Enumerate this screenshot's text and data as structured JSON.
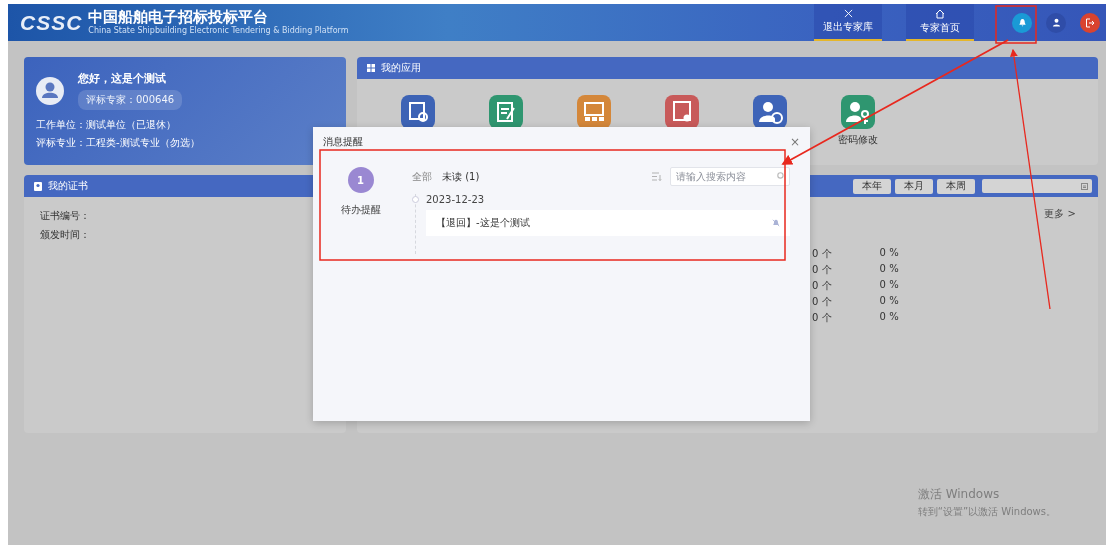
{
  "header": {
    "logo": "CSSC",
    "title": "中国船舶电子招标投标平台",
    "subtitle": "China State Shipbuilding Electronic Tendering & Bidding Platform",
    "nav": [
      {
        "kind": "exit",
        "label": "退出专家库"
      },
      {
        "kind": "home",
        "label": "专家首页"
      }
    ],
    "actions": [
      {
        "kind": "bell"
      },
      {
        "kind": "user"
      },
      {
        "kind": "logout"
      }
    ]
  },
  "welcome": {
    "greeting": "您好，这是个测试",
    "badge": "评标专家：000646",
    "lines": [
      "工作单位：测试单位（已退休）",
      "评标专业：工程类-测试专业（勿选）"
    ]
  },
  "apps": {
    "title": "我的应用",
    "items": [
      {
        "kind": "search-doc",
        "color": "#3d63b5"
      },
      {
        "kind": "edit-doc",
        "color": "#2f9670"
      },
      {
        "kind": "meeting",
        "color": "#d4873a"
      },
      {
        "kind": "certificate",
        "color": "#c85a5a"
      },
      {
        "kind": "user-clock",
        "color": "#3e64b8"
      },
      {
        "kind": "user-key",
        "color": "#2f9670",
        "label": "密码修改"
      }
    ]
  },
  "certificate": {
    "title": "我的证书",
    "fields": [
      "证书编号：",
      "颁发时间："
    ]
  },
  "stats": {
    "periods": [
      {
        "label": "本年"
      },
      {
        "label": "本月"
      },
      {
        "label": "本周"
      }
    ],
    "more": "更多 >",
    "rows": [
      {
        "count": "0",
        "count_unit": "个",
        "percent": "0",
        "percent_unit": "%"
      },
      {
        "count": "0",
        "count_unit": "个",
        "percent": "0",
        "percent_unit": "%"
      },
      {
        "count": "0",
        "count_unit": "个",
        "percent": "0",
        "percent_unit": "%"
      },
      {
        "count": "0",
        "count_unit": "个",
        "percent": "0",
        "percent_unit": "%"
      },
      {
        "count": "0",
        "count_unit": "个",
        "percent": "0",
        "percent_unit": "%"
      }
    ]
  },
  "modal": {
    "title": "消息提醒",
    "close": "×",
    "category": {
      "count": "1",
      "label": "待办提醒"
    },
    "tabs": [
      {
        "label": "全部",
        "selected": false
      },
      {
        "label": "未读 (1)",
        "selected": true
      }
    ],
    "search": {
      "placeholder": "请输入搜索内容"
    },
    "groups": [
      {
        "date": "2023-12-23",
        "messages": [
          "【退回】-这是个测试"
        ]
      }
    ]
  },
  "watermark": [
    "激活 Windows",
    "转到“设置”以激活 Windows。"
  ]
}
